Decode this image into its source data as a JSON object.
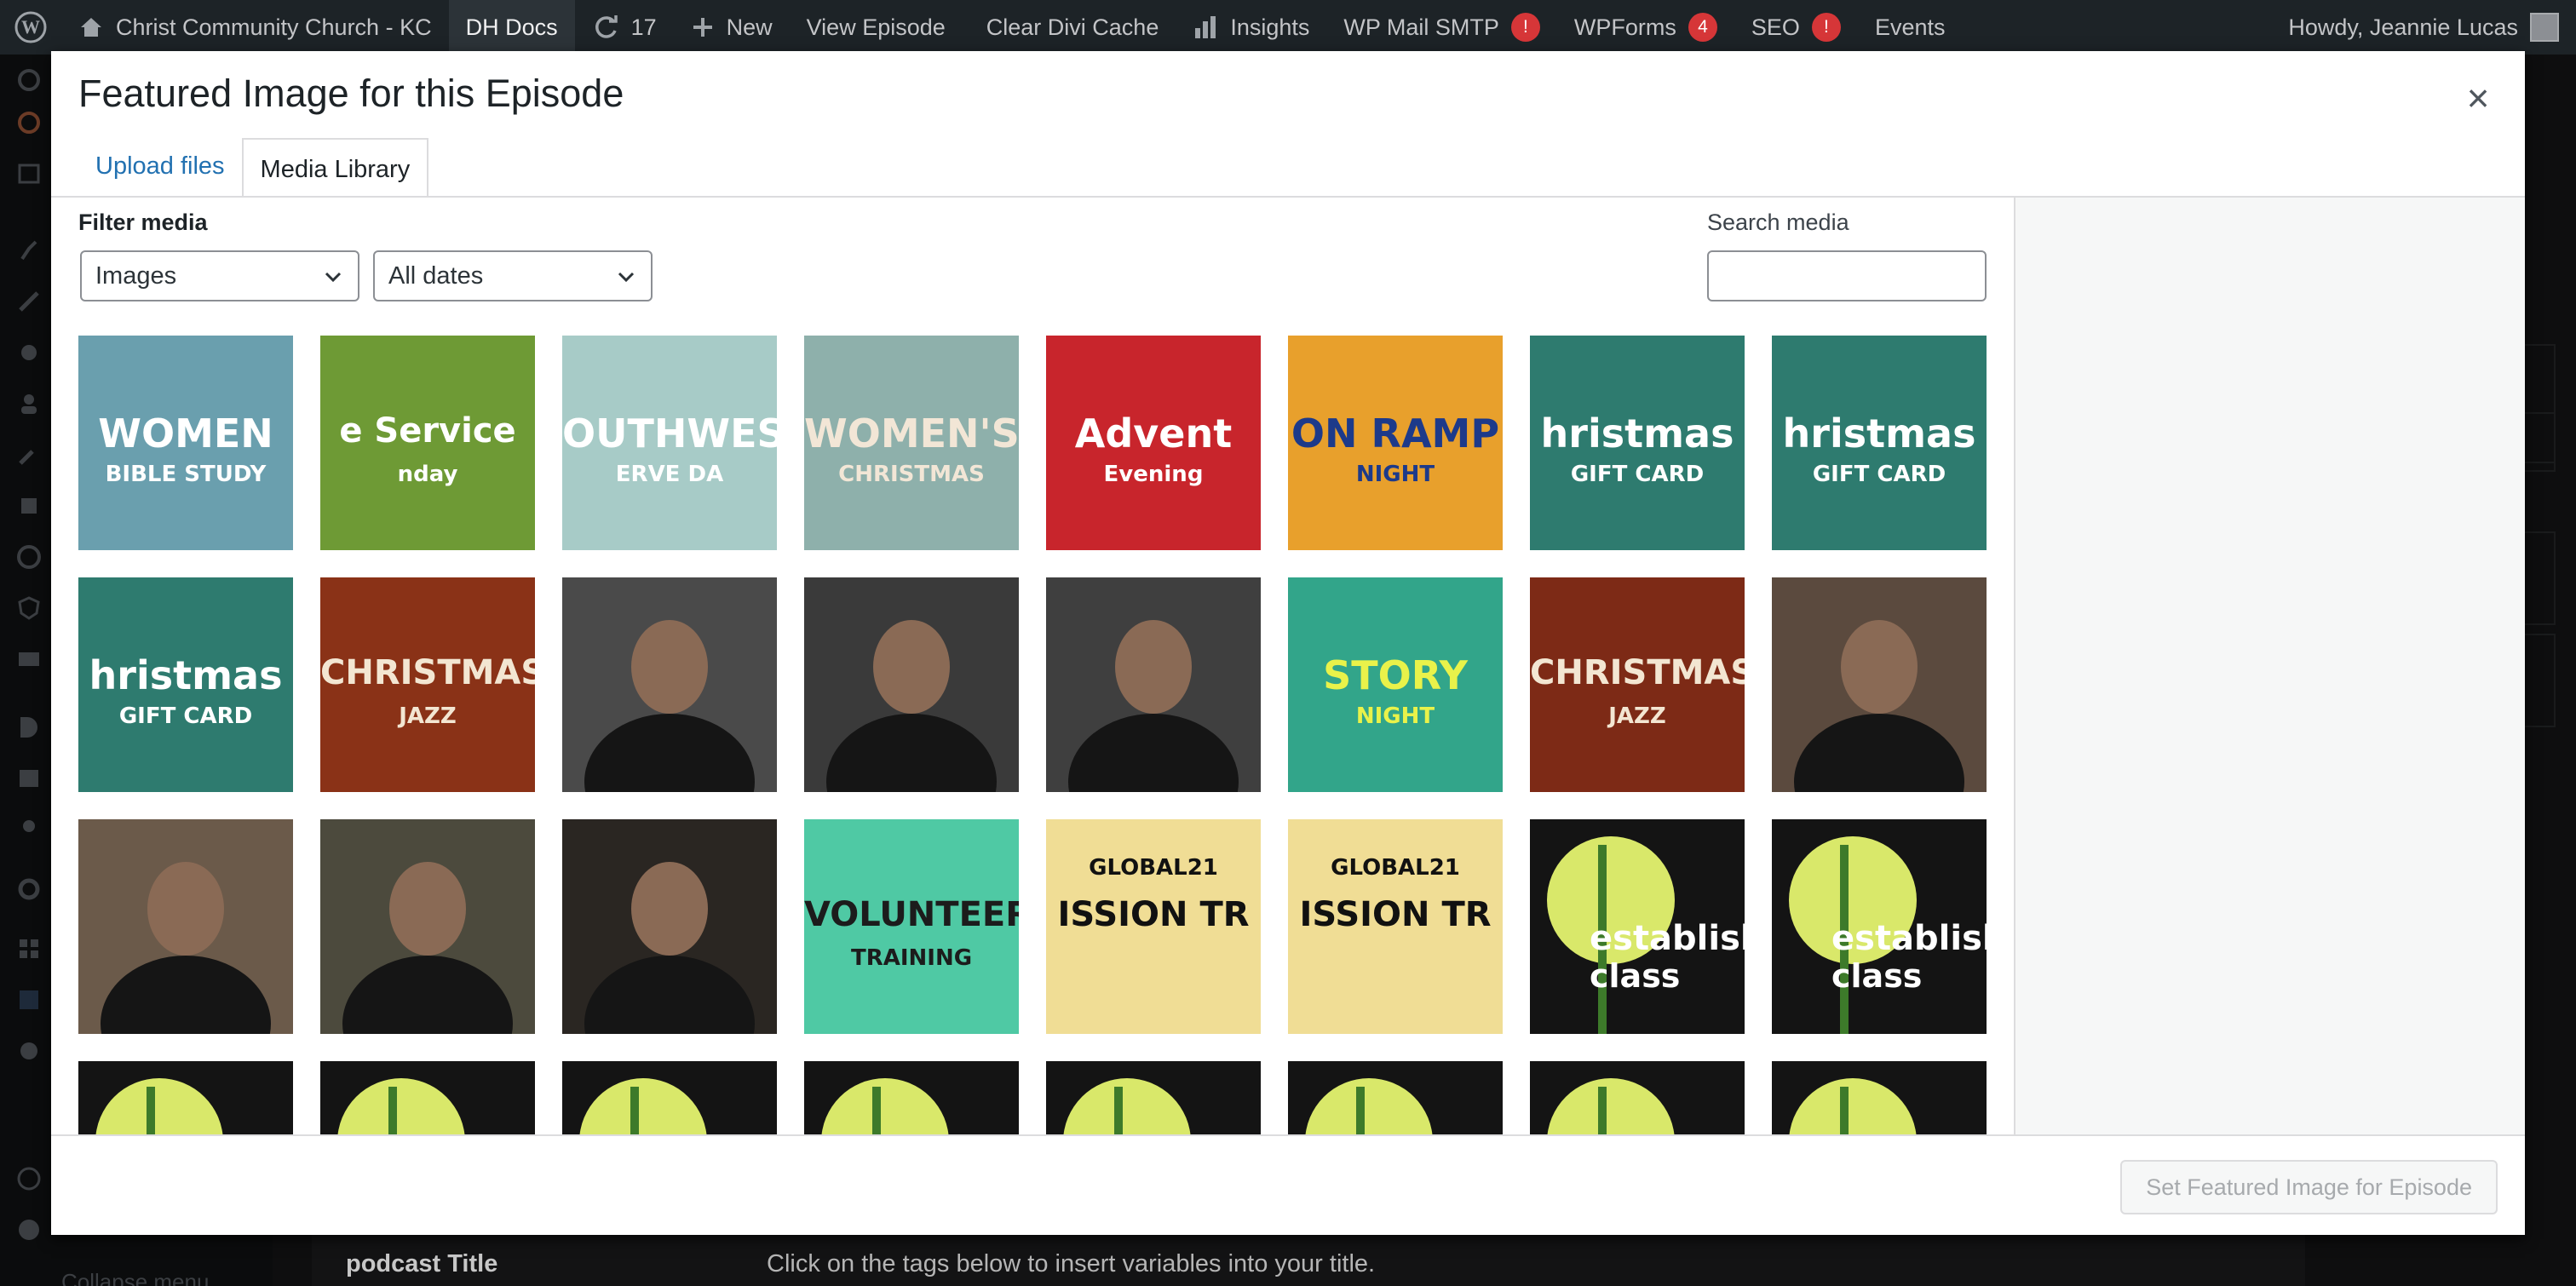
{
  "adminbar": {
    "site_name": "Christ Community Church - KC",
    "dh_docs": "DH Docs",
    "updates_count": "17",
    "new_label": "New",
    "view_episode": "View Episode",
    "clear_cache": "Clear Divi Cache",
    "insights": "Insights",
    "wp_mail": "WP Mail SMTP",
    "wp_mail_badge": "!",
    "wpforms": "WPForms",
    "wpforms_badge": "4",
    "seo": "SEO",
    "seo_badge": "!",
    "events": "Events",
    "howdy": "Howdy, Jeannie Lucas"
  },
  "background": {
    "podcast_title_label": "podcast Title",
    "podcast_hint": "Click on the tags below to insert variables into your title.",
    "collapse_menu": "Collapse menu"
  },
  "modal": {
    "title": "Featured Image for this Episode",
    "close_symbol": "×",
    "tabs": [
      "Upload files",
      "Media Library"
    ],
    "active_tab": "Media Library",
    "filter_label": "Filter media",
    "type_filter": "Images",
    "date_filter": "All dates",
    "search_label": "Search media",
    "search_value": "",
    "set_button": "Set Featured Image for Episode"
  },
  "media_items": [
    {
      "bg": "#6a9fae",
      "fg": "#ffffff",
      "text": "WOMEN",
      "sub": "BIBLE STUDY"
    },
    {
      "bg": "#6e9a35",
      "fg": "#ffffff",
      "text": "e Service",
      "sub": "nday"
    },
    {
      "bg": "#a7cbc7",
      "fg": "#ffffff",
      "text": "OUTHWES",
      "sub": "ERVE DA"
    },
    {
      "bg": "#8eb0ab",
      "fg": "#f2e6d6",
      "text": "WOMEN'S",
      "sub": "CHRISTMAS"
    },
    {
      "bg": "#c8252c",
      "fg": "#ffffff",
      "text": "Advent",
      "sub": "Evening"
    },
    {
      "bg": "#e8a02c",
      "fg": "#1d3a8a",
      "text": "ON RAMP",
      "sub": "NIGHT"
    },
    {
      "bg": "#2e7b6f",
      "fg": "#ffffff",
      "text": "hristmas",
      "sub": "GIFT CARD"
    },
    {
      "bg": "#2e7b6f",
      "fg": "#ffffff",
      "text": "hristmas",
      "sub": "GIFT CARD"
    },
    {
      "bg": "#2e7b6f",
      "fg": "#ffffff",
      "text": "hristmas",
      "sub": "GIFT CARD"
    },
    {
      "bg": "#8a3217",
      "fg": "#f3e6d2",
      "text": "CHRISTMAS",
      "sub": "JAZZ"
    },
    {
      "bg": "#4a4a4a",
      "fg": "#111111",
      "text": "",
      "sub": ""
    },
    {
      "bg": "#3a3a3a",
      "fg": "#111111",
      "text": "",
      "sub": ""
    },
    {
      "bg": "#3f3f3f",
      "fg": "#111111",
      "text": "",
      "sub": ""
    },
    {
      "bg": "#32a58a",
      "fg": "#e9f24a",
      "text": "STORY",
      "sub": "NIGHT"
    },
    {
      "bg": "#7d2a16",
      "fg": "#f3e6d2",
      "text": "CHRISTMAS",
      "sub": "JAZZ"
    },
    {
      "bg": "#5b4a3e",
      "fg": "#111111",
      "text": "",
      "sub": ""
    },
    {
      "bg": "#6b5a4a",
      "fg": "#111111",
      "text": "",
      "sub": ""
    },
    {
      "bg": "#4c4a3d",
      "fg": "#111111",
      "text": "",
      "sub": ""
    },
    {
      "bg": "#2a2622",
      "fg": "#111111",
      "text": "",
      "sub": ""
    },
    {
      "bg": "#4fc9a4",
      "fg": "#1c1c1c",
      "text": "VOLUNTEER",
      "sub": "TRAINING"
    },
    {
      "bg": "#f0dd95",
      "fg": "#111111",
      "text": "ISSION TR",
      "sub": "GLOBAL21"
    },
    {
      "bg": "#f0dd95",
      "fg": "#111111",
      "text": "ISSION TR",
      "sub": "GLOBAL21"
    },
    {
      "bg": "#141414",
      "fg": "#ffffff",
      "text": "establishe",
      "sub": "class"
    },
    {
      "bg": "#141414",
      "fg": "#ffffff",
      "text": "establishe",
      "sub": "class"
    },
    {
      "bg": "#141414",
      "fg": "#ffffff",
      "text": "",
      "sub": ""
    },
    {
      "bg": "#141414",
      "fg": "#ffffff",
      "text": "",
      "sub": ""
    },
    {
      "bg": "#141414",
      "fg": "#ffffff",
      "text": "",
      "sub": ""
    },
    {
      "bg": "#141414",
      "fg": "#ffffff",
      "text": "",
      "sub": ""
    },
    {
      "bg": "#141414",
      "fg": "#ffffff",
      "text": "",
      "sub": ""
    },
    {
      "bg": "#141414",
      "fg": "#ffffff",
      "text": "",
      "sub": ""
    },
    {
      "bg": "#141414",
      "fg": "#ffffff",
      "text": "",
      "sub": ""
    },
    {
      "bg": "#141414",
      "fg": "#ffffff",
      "text": "",
      "sub": ""
    }
  ]
}
